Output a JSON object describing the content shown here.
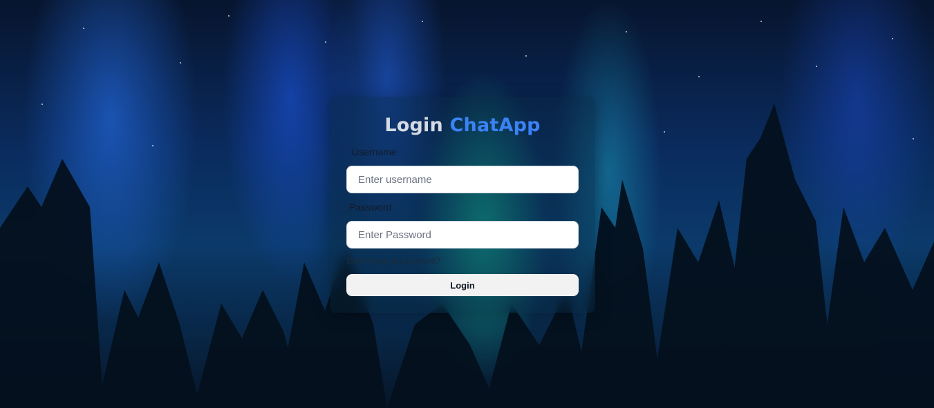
{
  "background": {
    "description_icon": "aurora-forest-background",
    "colors": {
      "sky_dark": "#07152e",
      "aurora_blue": "#2878ff",
      "aurora_green": "#14dca0",
      "tree": "#04101d"
    }
  },
  "login_card": {
    "title_prefix": "Login",
    "title_brand": "ChatApp",
    "brand_color": "#3b82f6",
    "username": {
      "label": "Username",
      "placeholder": "Enter username",
      "value": ""
    },
    "password": {
      "label": "Password",
      "placeholder": "Enter Password",
      "value": ""
    },
    "signup_link": "Don't have an account?",
    "login_button": "Login"
  }
}
